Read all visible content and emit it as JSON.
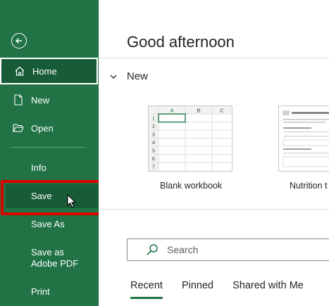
{
  "sidebar": {
    "items": [
      {
        "label": "Home"
      },
      {
        "label": "New"
      },
      {
        "label": "Open"
      },
      {
        "label": "Info"
      },
      {
        "label": "Save"
      },
      {
        "label": "Save As"
      },
      {
        "label": "Save as Adobe PDF"
      },
      {
        "label": "Print"
      }
    ]
  },
  "main": {
    "greeting": "Good afternoon",
    "new_section_title": "New",
    "templates": [
      {
        "label": "Blank workbook"
      },
      {
        "label": "Nutrition t"
      }
    ],
    "search_placeholder": "Search",
    "tabs": [
      {
        "label": "Recent"
      },
      {
        "label": "Pinned"
      },
      {
        "label": "Shared with Me"
      }
    ]
  },
  "colors": {
    "sidebar_bg": "#217346",
    "selected_bg": "#185c37",
    "highlight": "#e00000"
  },
  "blank_workbook_grid": {
    "columns": [
      "A",
      "B",
      "C"
    ],
    "rows": [
      "1",
      "2",
      "3",
      "4",
      "5",
      "6",
      "7"
    ]
  }
}
